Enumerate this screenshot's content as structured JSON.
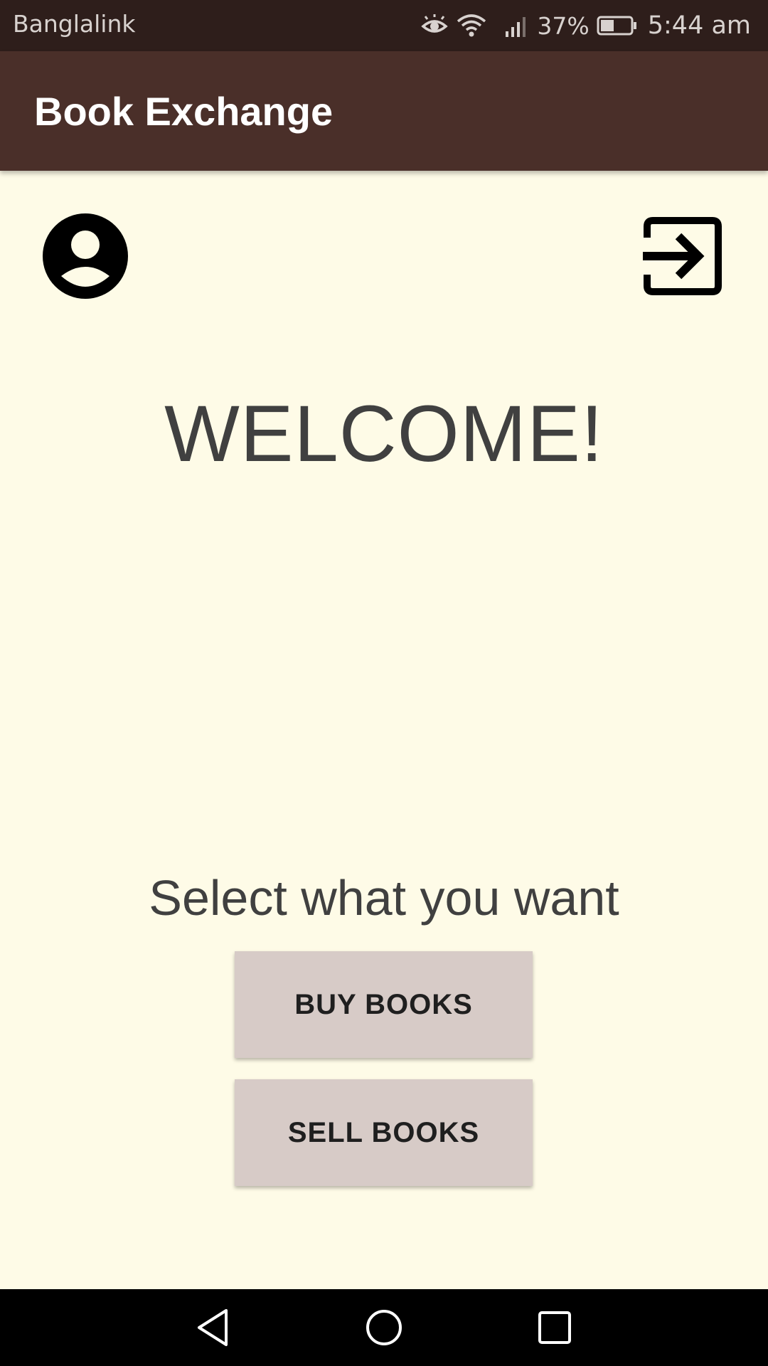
{
  "status_bar": {
    "carrier": "Banglalink",
    "battery_percent": "37%",
    "time": "5:44 am",
    "icons": [
      "eye-icon",
      "wifi-icon",
      "signal-icon",
      "battery-icon"
    ]
  },
  "app_bar": {
    "title": "Book Exchange",
    "background_color": "#4a2f29"
  },
  "header_icons": {
    "profile": "account-circle-icon",
    "logout": "exit-to-app-icon"
  },
  "main": {
    "welcome": "WELCOME!",
    "prompt": "Select what you want",
    "buy_label": "BUY BOOKS",
    "sell_label": "SELL BOOKS",
    "background_color": "#fefbe7",
    "button_color": "#d7cbc7"
  },
  "nav_bar": {
    "icons": [
      "back-icon",
      "home-icon",
      "recents-icon"
    ]
  }
}
